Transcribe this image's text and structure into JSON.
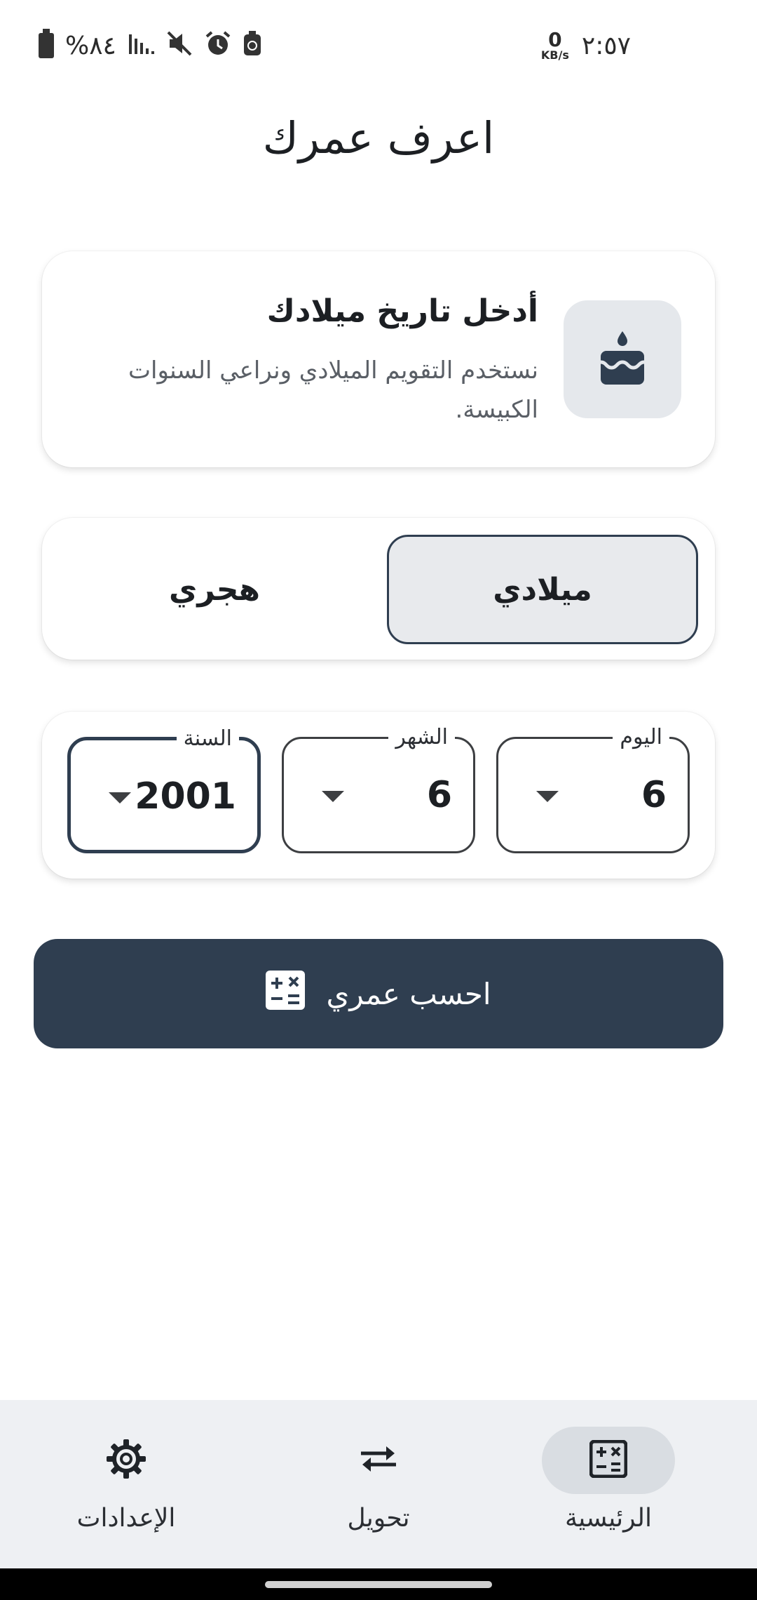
{
  "status_bar": {
    "time": "٢:٥٧",
    "net_speed_value": "0",
    "net_speed_unit": "KB/s",
    "battery_percent": "%٨٤",
    "icons": [
      "battery-icon",
      "signal-icon",
      "mute-icon",
      "alarm-icon",
      "recycle-icon"
    ]
  },
  "header": {
    "title": "اعرف عمرك"
  },
  "info_card": {
    "icon": "cake-icon",
    "title": "أدخل تاريخ ميلادك",
    "description": "نستخدم التقويم الميلادي ونراعي السنوات الكبيسة."
  },
  "calendar_toggle": {
    "gregorian_label": "ميلادي",
    "hijri_label": "هجري",
    "selected": "gregorian"
  },
  "date_inputs": {
    "day": {
      "label": "اليوم",
      "value": "6"
    },
    "month": {
      "label": "الشهر",
      "value": "6"
    },
    "year": {
      "label": "السنة",
      "value": "2001"
    }
  },
  "calculate_button": {
    "label": "احسب عمري",
    "icon": "calculator-icon"
  },
  "bottom_nav": {
    "items": [
      {
        "label": "الرئيسية",
        "icon": "calculator-icon",
        "active": true
      },
      {
        "label": "تحويل",
        "icon": "swap-arrows-icon",
        "active": false
      },
      {
        "label": "الإعدادات",
        "icon": "gear-icon",
        "active": false
      }
    ]
  },
  "colors": {
    "primary": "#2f3e50",
    "surface": "#ffffff",
    "nav_background": "#eef0f3",
    "chip_background": "#e5e8ec"
  }
}
